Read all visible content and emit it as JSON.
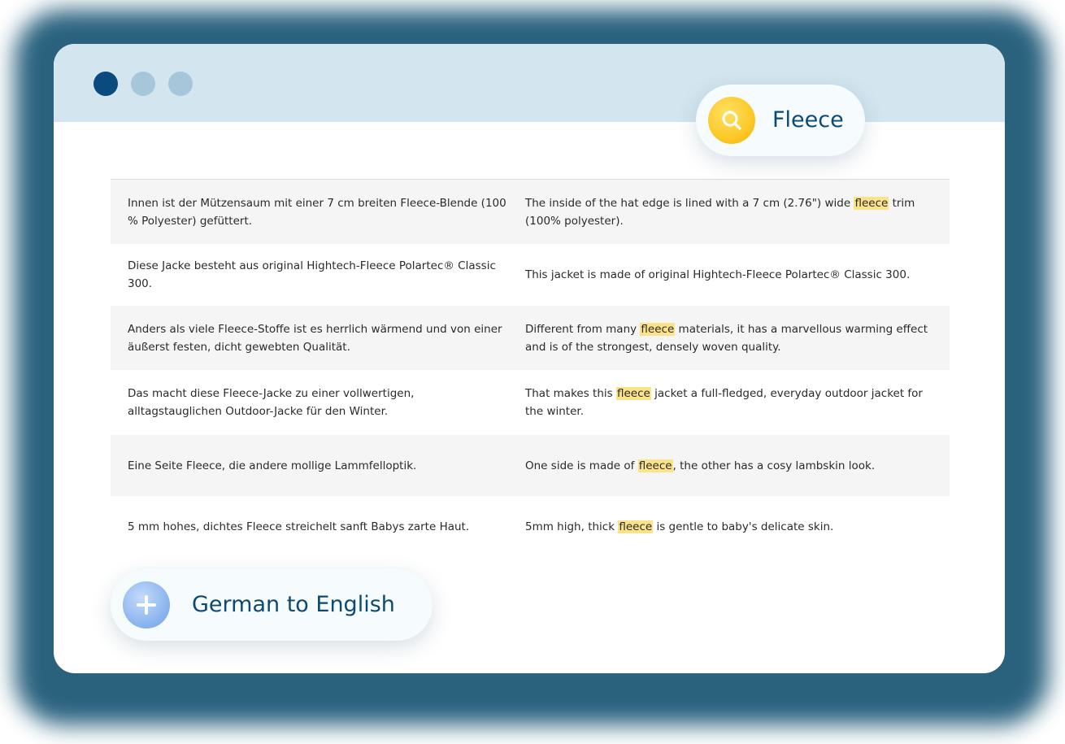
{
  "search": {
    "query": "Fleece"
  },
  "language_pair": {
    "label": "German to English"
  },
  "highlight_term": "fleece",
  "rows": [
    {
      "de": "Innen ist der Mützensaum mit einer 7 cm breiten Fleece-Blende (100 % Polyester) gefüttert.",
      "en": "The inside of the hat edge is lined with a 7 cm (2.76\") wide fleece trim (100% polyester)."
    },
    {
      "de": "Diese Jacke besteht aus original Hightech-Fleece Polartec® Classic 300.",
      "en": "This jacket is made of original Hightech-Fleece Polartec® Classic 300."
    },
    {
      "de": "Anders als viele Fleece-Stoffe ist es herrlich wärmend und von einer äußerst festen, dicht gewebten Qualität.",
      "en": "Different from many fleece materials, it has a marvellous warming effect and is of the strongest, densely woven quality."
    },
    {
      "de": "Das macht diese Fleece-Jacke zu einer vollwertigen, alltagstauglichen Outdoor-Jacke für den Winter.",
      "en": "That makes this fleece jacket a full-fledged, everyday outdoor jacket for the winter."
    },
    {
      "de": "Eine Seite Fleece, die andere mollige Lammfelloptik.",
      "en": "One side is made of fleece, the other has a cosy lambskin look."
    },
    {
      "de": "5 mm hohes, dichtes Fleece streichelt sanft Babys zarte Haut.",
      "en": "5mm high, thick fleece is gentle to baby's delicate skin."
    }
  ],
  "colors": {
    "titlebar": "#d3e5ef",
    "window_dot_active": "#0b4a7d",
    "window_dot_inactive": "#a6c7da",
    "highlight": "#fbe38a",
    "accent_text": "#0d4a73",
    "glow": "#1f5a78"
  },
  "icons": [
    "search-icon",
    "plus-icon"
  ]
}
